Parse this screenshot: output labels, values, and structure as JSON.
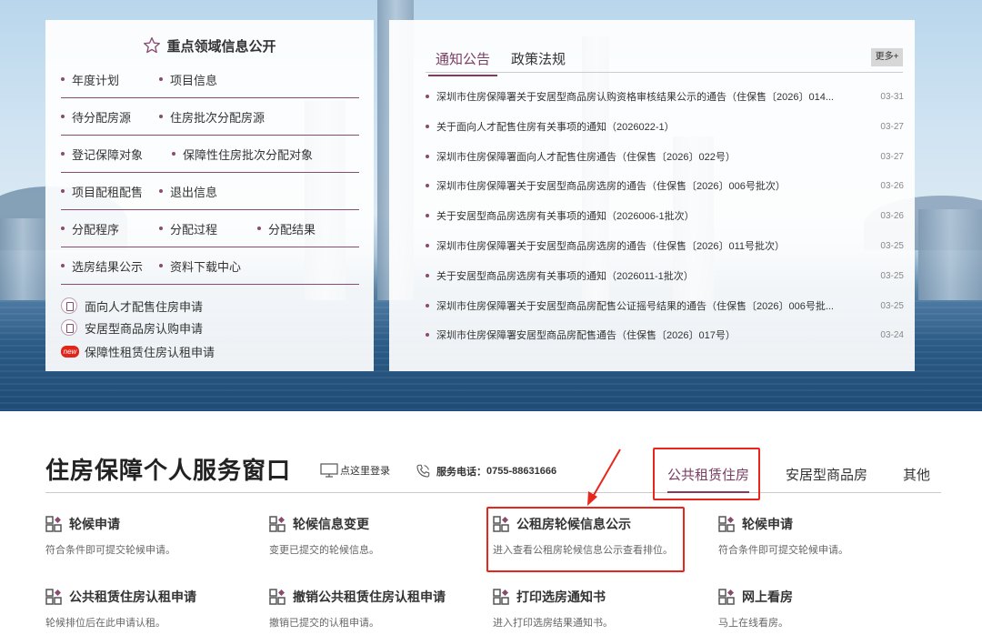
{
  "colors": {
    "accent": "#7a3d63",
    "highlight_red": "#e8261c",
    "badge_red": "#e2231a"
  },
  "key_areas": {
    "title": "重点领域信息公开",
    "rows": [
      [
        "年度计划",
        "项目信息"
      ],
      [
        "待分配房源",
        "住房批次分配房源"
      ],
      [
        "登记保障对象",
        "保障性住房批次分配对象"
      ],
      [
        "项目配租配售",
        "退出信息"
      ],
      [
        "分配程序",
        "分配过程",
        "分配结果"
      ],
      [
        "选房结果公示",
        "资料下载中心"
      ]
    ],
    "special_links": [
      {
        "label": "面向人才配售住房申请",
        "icon": "document-icon"
      },
      {
        "label": "安居型商品房认购申请",
        "icon": "document-icon"
      },
      {
        "label": "保障性租赁住房认租申请",
        "icon": "new-badge-icon",
        "badge": "new"
      }
    ]
  },
  "notices": {
    "tabs": [
      "通知公告",
      "政策法规"
    ],
    "active_tab": "通知公告",
    "more_label": "更多+",
    "items": [
      {
        "title": "深圳市住房保障署关于安居型商品房认购资格审核结果公示的通告（住保售〔2026〕014...",
        "date": "03-31"
      },
      {
        "title": "关于面向人才配售住房有关事项的通知（2026022-1）",
        "date": "03-27"
      },
      {
        "title": "深圳市住房保障署面向人才配售住房通告（住保售〔2026〕022号）",
        "date": "03-27"
      },
      {
        "title": "深圳市住房保障署关于安居型商品房选房的通告（住保售〔2026〕006号批次）",
        "date": "03-26"
      },
      {
        "title": "关于安居型商品房选房有关事项的通知（2026006-1批次）",
        "date": "03-26"
      },
      {
        "title": "深圳市住房保障署关于安居型商品房选房的通告（住保售〔2026〕011号批次）",
        "date": "03-25"
      },
      {
        "title": "关于安居型商品房选房有关事项的通知（2026011-1批次）",
        "date": "03-25"
      },
      {
        "title": "深圳市住房保障署关于安居型商品房配售公证摇号结果的通告（住保售〔2026〕006号批...",
        "date": "03-25"
      },
      {
        "title": "深圳市住房保障署安居型商品房配售通告（住保售〔2026〕017号）",
        "date": "03-24"
      }
    ]
  },
  "service": {
    "title": "住房保障个人服务窗口",
    "login_label": "点这里登录",
    "phone_label": "服务电话：",
    "phone": "0755-88631666",
    "categories": [
      "公共租赁住房",
      "安居型商品房",
      "其他"
    ],
    "active_category": "公共租赁住房",
    "items": [
      {
        "title": "轮候申请",
        "desc": "符合条件即可提交轮候申请。"
      },
      {
        "title": "轮候信息变更",
        "desc": "变更已提交的轮候信息。"
      },
      {
        "title": "公租房轮候信息公示",
        "desc": "进入查看公租房轮候信息公示查看排位。"
      },
      {
        "title": "轮候申请",
        "desc": "符合条件即可提交轮候申请。"
      },
      {
        "title": "公共租赁住房认租申请",
        "desc": "轮候排位后在此申请认租。"
      },
      {
        "title": "撤销公共租赁住房认租申请",
        "desc": "撤销已提交的认租申请。"
      },
      {
        "title": "打印选房通知书",
        "desc": "进入打印选房结果通知书。"
      },
      {
        "title": "网上看房",
        "desc": "马上在线看房。"
      }
    ]
  }
}
